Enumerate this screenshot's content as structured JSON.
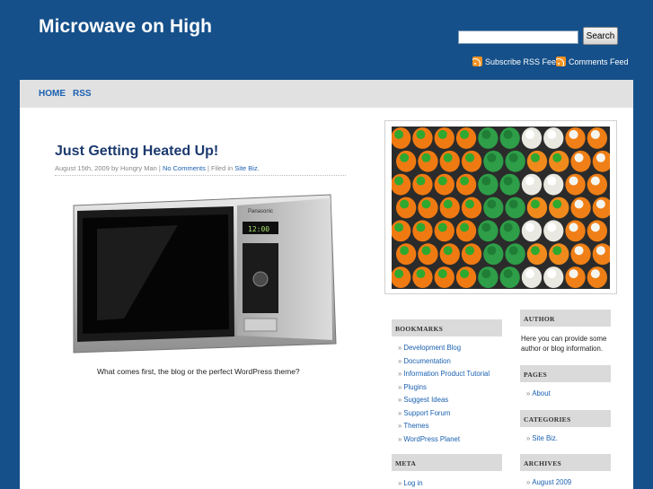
{
  "site": {
    "title": "Microwave on High"
  },
  "search": {
    "button_label": "Search",
    "value": ""
  },
  "feeds": {
    "rss_label": "Subscribe RSS Feed",
    "comments_label": "Comments Feed"
  },
  "nav": {
    "home_label": "HOME",
    "rss_label": "RSS"
  },
  "post": {
    "title": "Just Getting Heated Up!",
    "date": "August 15th, 2009 by Hungry Man |",
    "comments_link": "No Comments",
    "filed_text": "| Filed in",
    "category_link": "Site Biz.",
    "caption": "What comes first, the blog or the perfect WordPress theme?",
    "microwave_brand": "Panasonic",
    "microwave_display": "12:00"
  },
  "bookmarks": {
    "heading": "BOOKMARKS",
    "items": [
      "Development Blog",
      "Documentation",
      "Information Product Tutorial",
      "Plugins",
      "Suggest Ideas",
      "Support Forum",
      "Themes",
      "WordPress Planet"
    ]
  },
  "meta": {
    "heading": "META",
    "items": [
      "Log in"
    ]
  },
  "author": {
    "heading": "AUTHOR",
    "text": "Here you can provide some author or blog information."
  },
  "pages": {
    "heading": "PAGES",
    "items": [
      "About"
    ]
  },
  "categories": {
    "heading": "CATEGORIES",
    "items": [
      "Site Biz."
    ]
  },
  "archives": {
    "heading": "ARCHIVES",
    "items": [
      "August 2009"
    ]
  },
  "colors": {
    "background": "#15508a",
    "link": "#1a60b0",
    "title": "#1c3a6e",
    "nav_bar": "#e1e1e1",
    "widget_head": "#dadada"
  },
  "icons": {
    "feed": "rss-feed-icon",
    "bullet": "»"
  }
}
